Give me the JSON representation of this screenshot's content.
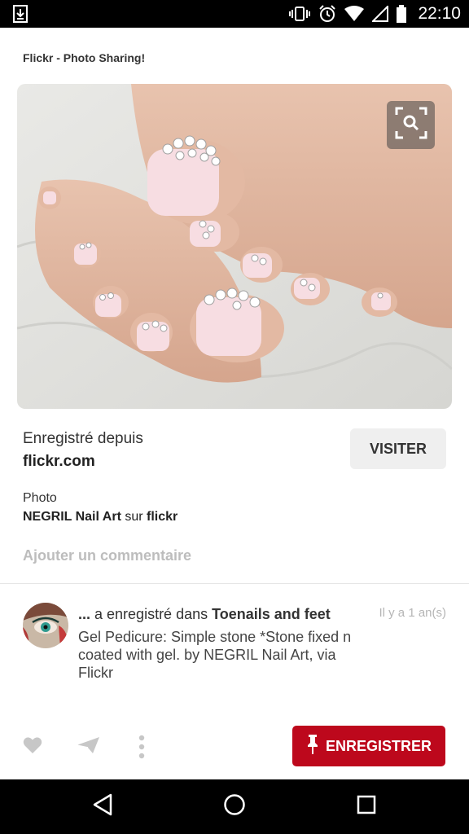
{
  "status_bar": {
    "time": "22:10",
    "icons": [
      "download-icon",
      "vibrate-icon",
      "alarm-icon",
      "wifi-icon",
      "signal-icon",
      "battery-icon"
    ]
  },
  "page": {
    "title": "Flickr - Photo Sharing!"
  },
  "pin": {
    "image_icon": "feet-with-jeweled-toenails",
    "zoom_icon": "visual-search-icon",
    "saved_from_label": "Enregistré depuis",
    "saved_from_domain": "flickr.com",
    "visit_label": "VISITER",
    "photo_label": "Photo",
    "credit_author": "NEGRIL Nail Art",
    "credit_sep": " sur ",
    "credit_site": "flickr",
    "add_comment_placeholder": "Ajouter un commentaire"
  },
  "activity": {
    "user": "...",
    "action": " a enregistré dans ",
    "board": "Toenails and feet",
    "timestamp": "Il y a 1 an(s)",
    "description": "Gel Pedicure: Simple stone *Stone fixed n coated with gel. by NEGRIL Nail Art, via Flickr"
  },
  "actions": {
    "like_icon": "heart-icon",
    "send_icon": "send-icon",
    "more_icon": "more-vertical-icon",
    "save_label": "ENREGISTRER",
    "save_icon": "pin-icon",
    "save_color": "#bd081c"
  },
  "nav": {
    "icons": [
      "back-icon",
      "home-icon",
      "recents-icon"
    ]
  }
}
